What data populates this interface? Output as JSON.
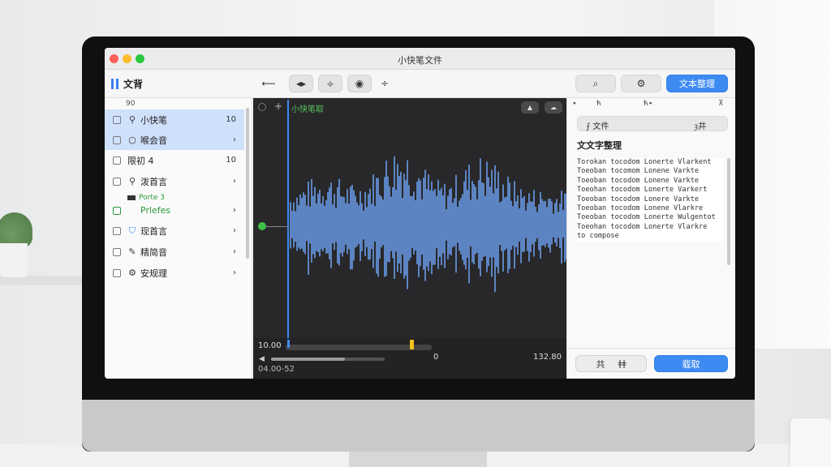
{
  "window": {
    "title": "小快笔文件"
  },
  "toolbar": {
    "sidebar_title": "文背",
    "back_icon_glyph": "⟵",
    "waveform_icon_glyph": "◂▸",
    "wave_icon_glyph": "⟡",
    "target_icon_glyph": "◉",
    "split_icon_glyph": "÷",
    "search_icon_glyph": "⌕",
    "settings_icon_glyph": "⚙",
    "primary_button": "文本整理"
  },
  "sidebar": {
    "count": "90",
    "items": [
      {
        "icon": "pin-icon",
        "glyph": "⚲",
        "label": "小快笔",
        "value": "10",
        "selected": true
      },
      {
        "icon": "circle-icon",
        "glyph": "○",
        "label": "喉会音",
        "value": "›",
        "selected": true
      },
      {
        "icon": "",
        "glyph": "",
        "label": "限初 4",
        "value": "10",
        "selected": false
      },
      {
        "icon": "pin-icon",
        "glyph": "⚲",
        "label": "泼首言",
        "value": "›",
        "selected": false
      }
    ],
    "group_label": "Porte 3",
    "items2": [
      {
        "icon": "",
        "glyph": "",
        "label": "Prlefes",
        "value": "›",
        "green": true
      },
      {
        "icon": "shield-icon",
        "glyph": "⛉",
        "label": "现首言",
        "value": "›"
      },
      {
        "icon": "edit-icon",
        "glyph": "✎",
        "label": "精简音",
        "value": "›"
      },
      {
        "icon": "settings-icon",
        "glyph": "⚙",
        "label": "安规理",
        "value": "›"
      }
    ]
  },
  "editor": {
    "title": "小快笔取",
    "chip1": "▲",
    "chip2": "☁",
    "time_start": "10.00",
    "time_zero": "0",
    "time_end": "132.80",
    "time_bottom": "04.00-52",
    "playhead_position": 0.0,
    "marker_position": 0.85,
    "volume": 0.65
  },
  "panel": {
    "head_left": "∙",
    "head_mid1": "ћ",
    "head_mid2": "ћ∙",
    "head_right": "⊼",
    "seg_left": "⨍ 文件",
    "seg_right": "ȝ井",
    "title": "文文字整理",
    "text_lines": [
      "Torokan tocodom Lonerte Vlarkent",
      "Toeoban tocomom Lonene Varkte",
      "Toeoban tocodom Lonene Varkte",
      "Toeohan tocodom Lonerte Varkert",
      "Toeoban tocodom Lonere Varkte",
      "Toeoban tocodom Lonene Vlarkre",
      "Toeoban tocodom Lonerte Wulgentot",
      "Toeohan tocodom Lonerte Vlarkre",
      "to compose"
    ],
    "secondary_button_left": "共",
    "secondary_button_right": "ǂǂ",
    "primary_button": "载取"
  }
}
